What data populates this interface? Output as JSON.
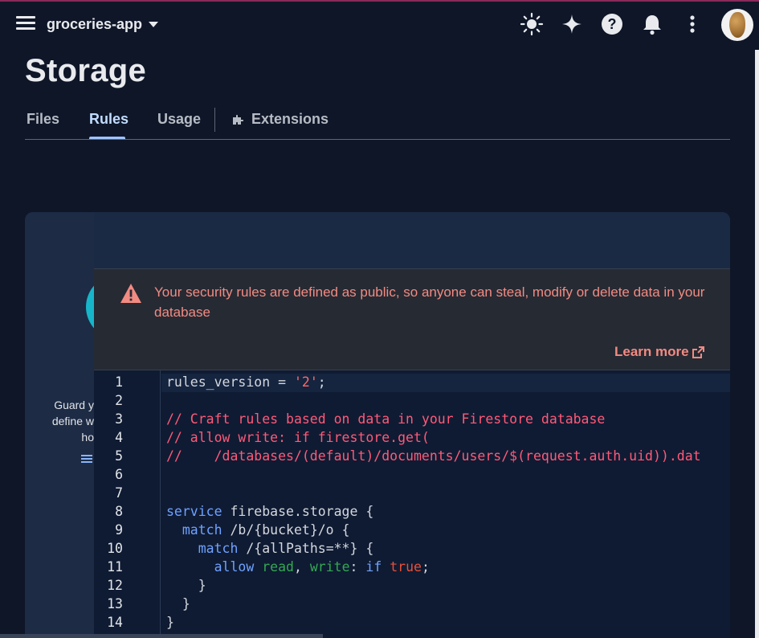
{
  "header": {
    "project_name": "groceries-app",
    "icons": [
      "theme-icon",
      "sparkle-icon",
      "help-icon",
      "notifications-icon",
      "more-vert-icon"
    ]
  },
  "page": {
    "title": "Storage"
  },
  "tabs": [
    {
      "label": "Files"
    },
    {
      "label": "Rules"
    },
    {
      "label": "Usage"
    },
    {
      "label": "Extensions"
    }
  ],
  "active_tab": "Rules",
  "side_panel": {
    "lines": [
      "Guard y",
      "define w",
      "ho"
    ]
  },
  "banner": {
    "message": "Your security rules are defined as public, so anyone can steal, modify or delete data in your database",
    "learn_more": "Learn more"
  },
  "editor": {
    "line_numbers": [
      "1",
      "2",
      "3",
      "4",
      "5",
      "6",
      "7",
      "8",
      "9",
      "10",
      "11",
      "12",
      "13",
      "14"
    ],
    "lines": [
      "rules_version = '2';",
      "",
      "// Craft rules based on data in your Firestore database",
      "// allow write: if firestore.get(",
      "//    /databases/(default)/documents/users/$(request.auth.uid)).dat",
      "",
      "",
      "service firebase.storage {",
      "  match /b/{bucket}/o {",
      "    match /{allPaths=**} {",
      "      allow read, write: if true;",
      "    }",
      "  }",
      "}"
    ]
  },
  "colors": {
    "background": "#0e1628",
    "accent_tab": "#9fc3ff",
    "warning_text": "#f28b82",
    "keyword": "#6fa2ff",
    "comment": "#ff5a78",
    "string": "#ff6b6b"
  }
}
